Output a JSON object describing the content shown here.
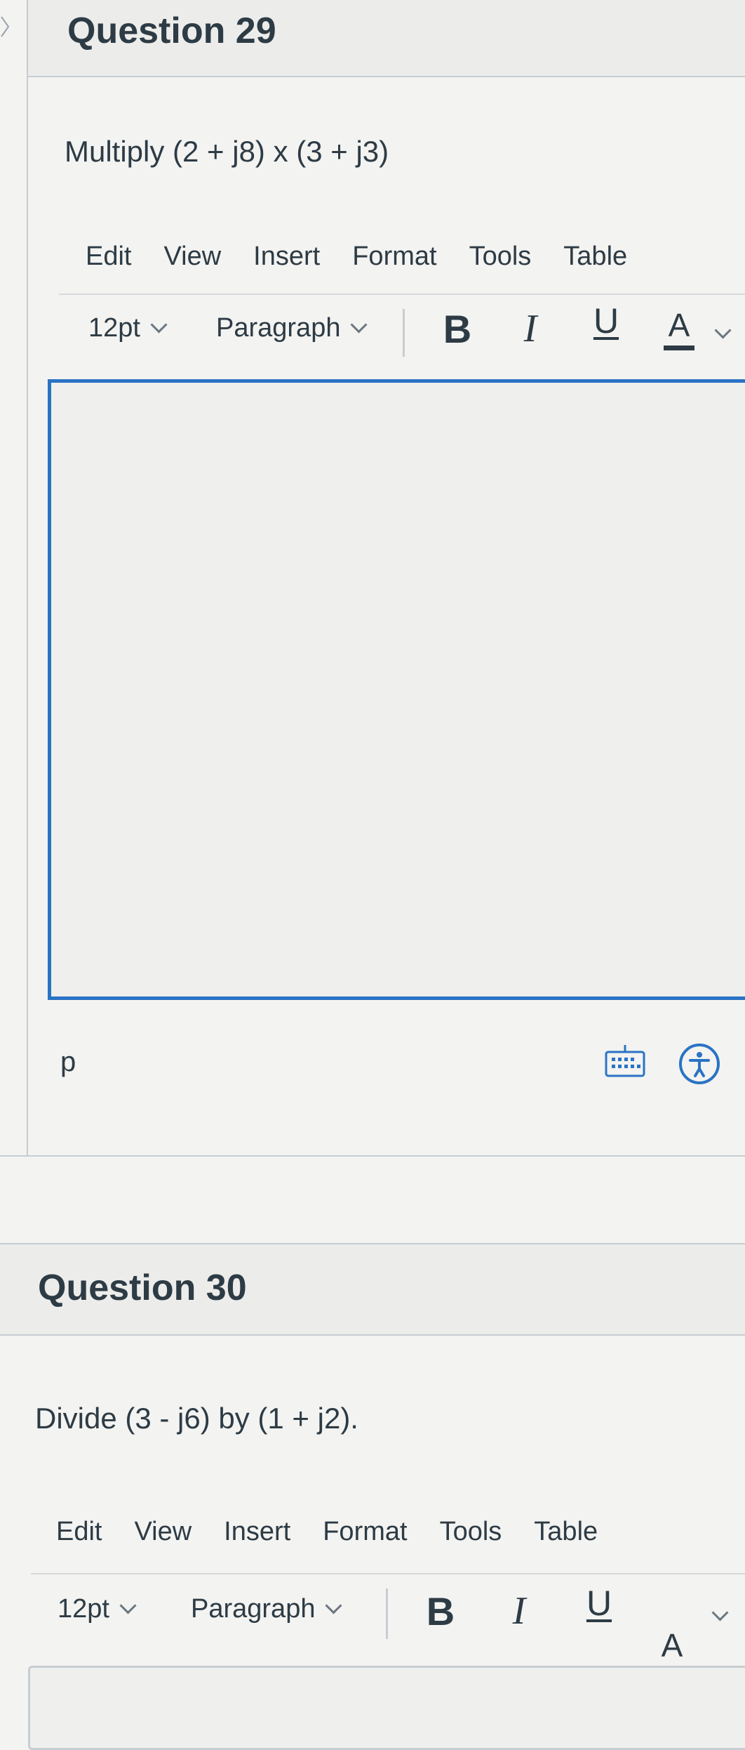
{
  "q29": {
    "title": "Question 29",
    "prompt": "Multiply (2 + j8) x (3 + j3)",
    "menu": [
      "Edit",
      "View",
      "Insert",
      "Format",
      "Tools",
      "Table"
    ],
    "font_size": "12pt",
    "block_format": "Paragraph",
    "format_buttons": {
      "bold": "B",
      "italic": "I",
      "underline": "U",
      "color": "A"
    },
    "status_path": "p"
  },
  "q30": {
    "title": "Question 30",
    "prompt": "Divide (3 - j6) by (1 + j2).",
    "menu": [
      "Edit",
      "View",
      "Insert",
      "Format",
      "Tools",
      "Table"
    ],
    "font_size": "12pt",
    "block_format": "Paragraph",
    "format_buttons": {
      "bold": "B",
      "italic": "I",
      "underline": "U",
      "color": "A"
    }
  },
  "icons": {
    "keyboard": "keyboard-icon",
    "accessibility": "accessibility-icon",
    "chevron": "chevron-down-icon"
  },
  "colors": {
    "editor_focus_border": "#2a73c5",
    "text": "#2d3b45",
    "divider": "#c7cdd1"
  }
}
